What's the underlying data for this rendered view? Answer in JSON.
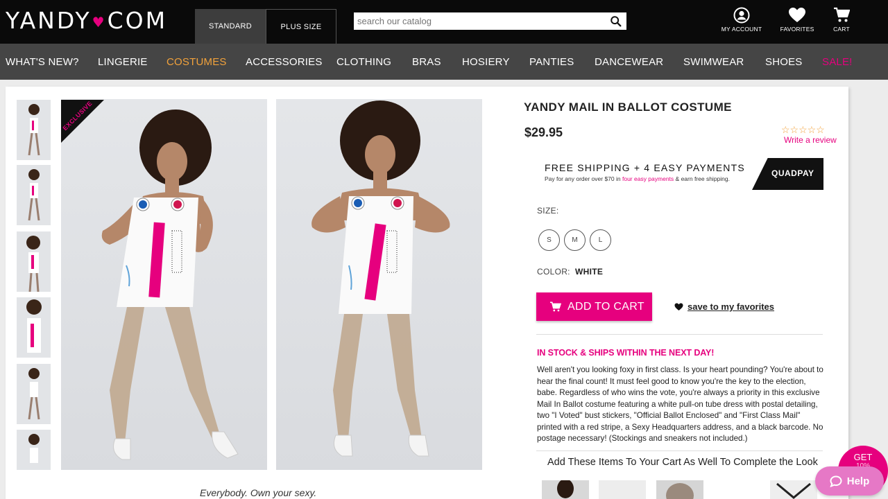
{
  "header": {
    "logo_left": "YANDY",
    "logo_right": "COM",
    "size_tabs": [
      {
        "label": "STANDARD",
        "active": true
      },
      {
        "label": "PLUS SIZE",
        "active": false
      }
    ],
    "search_placeholder": "search our catalog",
    "account_label": "MY ACCOUNT",
    "favorites_label": "FAVORITES",
    "cart_label": "CART"
  },
  "nav": {
    "items": [
      {
        "label": "WHAT'S NEW?"
      },
      {
        "label": "LINGERIE"
      },
      {
        "label": "COSTUMES",
        "active": true
      },
      {
        "label": "ACCESSORIES"
      },
      {
        "label": "CLOTHING"
      },
      {
        "label": "BRAS"
      },
      {
        "label": "HOSIERY"
      },
      {
        "label": "PANTIES"
      },
      {
        "label": "DANCEWEAR"
      },
      {
        "label": "SWIMWEAR"
      },
      {
        "label": "SHOES"
      },
      {
        "label": "SALE!",
        "sale": true
      }
    ]
  },
  "gallery": {
    "badge": "EXCLUSIVE",
    "tagline": "Everybody. Own your sexy."
  },
  "product": {
    "title": "YANDY MAIL IN BALLOT COSTUME",
    "price": "$29.95",
    "rating_stars": "☆☆☆☆☆",
    "write_review": "Write a review",
    "shipping_headline": "FREE SHIPPING + 4 EASY PAYMENTS",
    "shipping_sub_1": "Pay for any order over $70 in ",
    "shipping_sub_link": "four easy payments",
    "shipping_sub_2": " & earn free shipping.",
    "quadpay_label": "QUADPAY",
    "size_label": "SIZE:",
    "sizes": [
      "S",
      "M",
      "L"
    ],
    "color_label": "COLOR:",
    "color_value": "WHITE",
    "add_to_cart": "ADD TO CART",
    "save_favorites": "save to my favorites",
    "stock_status": "IN STOCK & SHIPS WITHIN THE NEXT DAY!",
    "description": "Well aren't you looking foxy in first class. Is your heart pounding? You're about to hear the final count! It must feel good to know you're the key to the election, babe. Regardless of who wins the vote, you're always a priority in this exclusive Mail In Ballot costume featuring a white pull-on tube dress with postal detailing, two \"I Voted\" bust stickers, \"Official Ballot Enclosed\" and \"First Class Mail\" printed with a red stripe, a Sexy Headquarters address, and a black barcode. No postage necessary! (Stockings and sneakers not included.)",
    "add_items_heading": "Add These Items To Your Cart As Well To Complete the Look"
  },
  "widgets": {
    "get_label": "GET",
    "get_sub": "10%",
    "help_label": "Help"
  },
  "colors": {
    "brand_pink": "#e6007e",
    "nav_active": "#f2a23b",
    "header_bg": "#0a0a0a",
    "nav_bg": "#454545"
  }
}
